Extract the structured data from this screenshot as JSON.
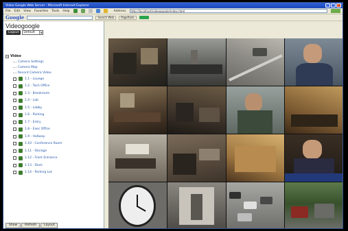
{
  "window": {
    "title": "Video Google Web Server - Microsoft Internet Explorer"
  },
  "menu": {
    "items": [
      "File",
      "Edit",
      "View",
      "Favorites",
      "Tools",
      "Help"
    ],
    "address_label": "Address",
    "address_value": "http://localhost/videogoogle/index.html",
    "go_label": "Go"
  },
  "google_bar": {
    "logo": "Google",
    "search_web_label": "Search Web",
    "pagerank_label": "PageRank"
  },
  "brand": "Videogoogle",
  "profile": {
    "logout_label": "Logout",
    "selected": "Default"
  },
  "tree": {
    "root_label": "Video",
    "links": [
      "Camera Settings",
      "Camera Map",
      "Record Camera Video"
    ],
    "cameras": [
      "1.1 - Lounge",
      "1.2 - Tech Office",
      "1.3 - Breakroom",
      "1.4 - Lab",
      "1.5 - Lobby",
      "1.6 - Parking",
      "1.7 - Entry",
      "1.8 - Exec Office",
      "1.9 - Hallway",
      "1.10 - Conference Room",
      "1.11 - Storage",
      "1.12 - Front Entrance",
      "1.13 - Dock",
      "1.14 - Parking Lot"
    ]
  },
  "left_buttons": [
    "Show",
    "Refresh",
    "Layout"
  ],
  "colors": {
    "titlebar": "#1a46b8",
    "link": "#2255aa"
  }
}
